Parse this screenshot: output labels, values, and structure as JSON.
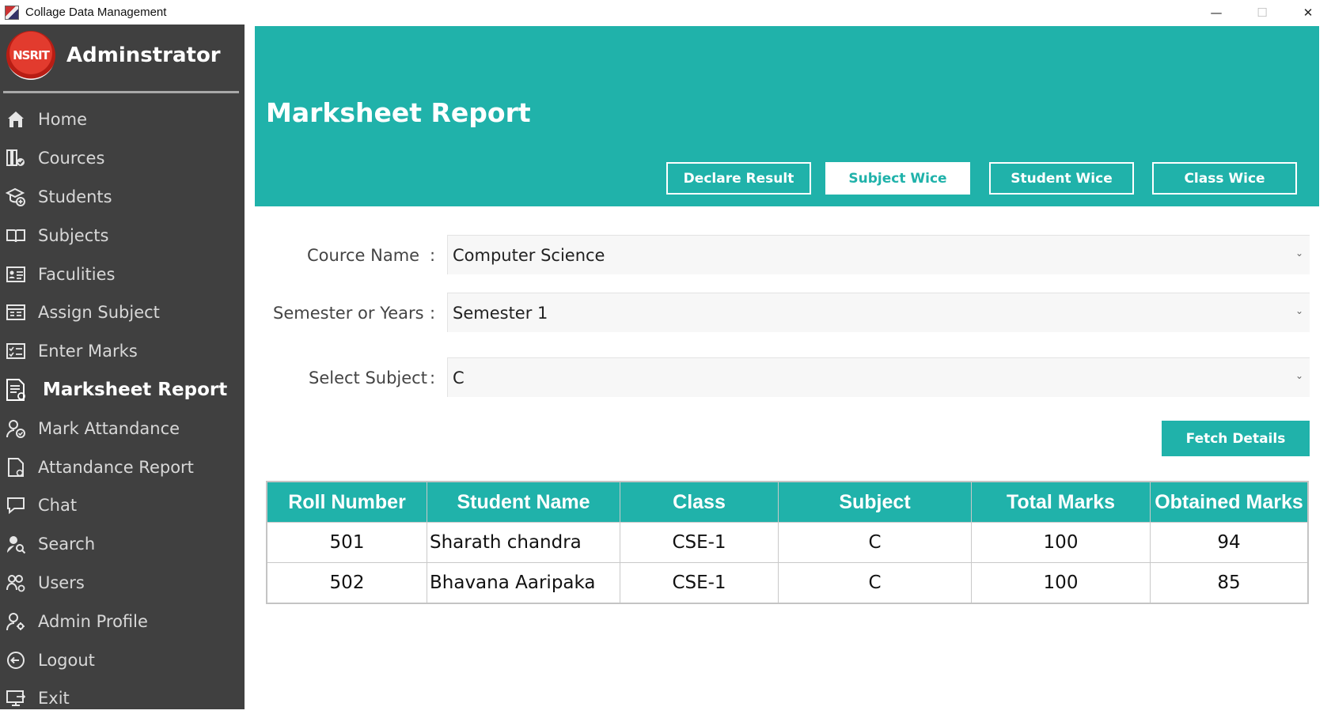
{
  "window": {
    "title": "Collage Data Management",
    "minimize": "—",
    "maximize": "☐",
    "close": "✕"
  },
  "sidebar": {
    "logo_text": "NSRIT",
    "title": "Adminstrator",
    "items": [
      {
        "label": "Home",
        "icon": "home-icon"
      },
      {
        "label": "Cources",
        "icon": "courses-icon"
      },
      {
        "label": "Students",
        "icon": "students-icon"
      },
      {
        "label": "Subjects",
        "icon": "book-icon"
      },
      {
        "label": "Faculities",
        "icon": "faculty-icon"
      },
      {
        "label": "Assign Subject",
        "icon": "assign-icon"
      },
      {
        "label": "Enter Marks",
        "icon": "marks-icon"
      },
      {
        "label": "Marksheet Report",
        "icon": "report-icon",
        "active": true
      },
      {
        "label": "Mark Attandance",
        "icon": "attendance-icon"
      },
      {
        "label": "Attandance Report",
        "icon": "document-icon"
      },
      {
        "label": "Chat",
        "icon": "chat-icon"
      },
      {
        "label": "Search",
        "icon": "search-user-icon"
      },
      {
        "label": "Users",
        "icon": "users-icon"
      },
      {
        "label": "Admin Profile",
        "icon": "admin-icon"
      },
      {
        "label": "Logout",
        "icon": "logout-icon"
      },
      {
        "label": "Exit",
        "icon": "exit-icon"
      }
    ]
  },
  "header": {
    "title": "Marksheet Report",
    "buttons": [
      "Declare Result",
      "Subject Wice",
      "Student Wice",
      "Class Wice"
    ],
    "active_button": "Subject Wice"
  },
  "form": {
    "course_label": "Cource Name",
    "course_value": "Computer Science",
    "semester_label": "Semester or Years",
    "semester_value": "Semester 1",
    "subject_label": "Select Subject",
    "subject_value": "C",
    "colon": ":",
    "chevron": "⌄",
    "fetch_label": "Fetch Details"
  },
  "table": {
    "headers": [
      "Roll Number",
      "Student Name",
      "Class",
      "Subject",
      "Total Marks",
      "Obtained Marks"
    ],
    "rows": [
      [
        "501",
        "Sharath chandra",
        "CSE-1",
        "C",
        "100",
        "94"
      ],
      [
        "502",
        "Bhavana Aaripaka",
        "CSE-1",
        "C",
        "100",
        "85"
      ]
    ]
  },
  "colors": {
    "accent": "#20b2aa",
    "sidebar": "#404040"
  }
}
